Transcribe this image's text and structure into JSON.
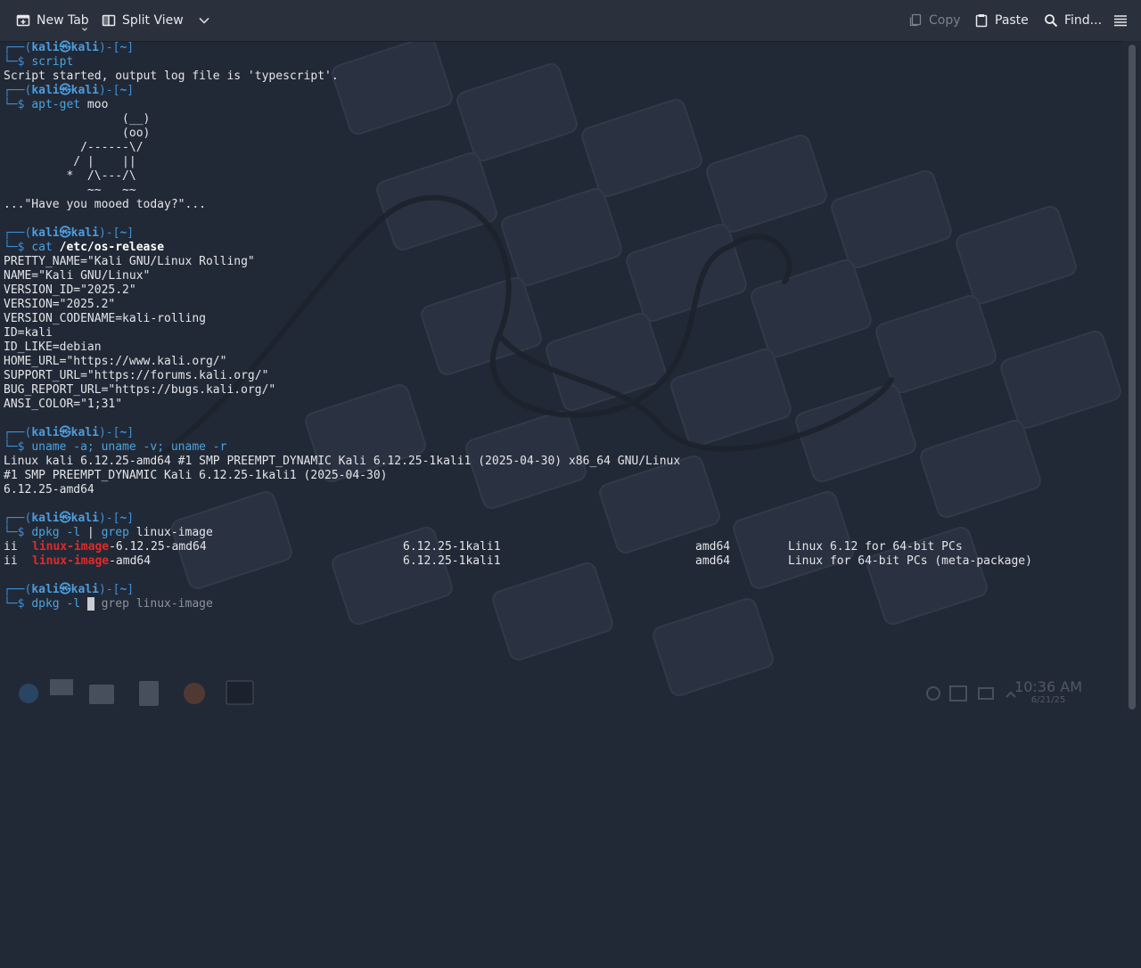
{
  "toolbar": {
    "new_tab": "New Tab",
    "split_view": "Split View",
    "copy": "Copy",
    "paste": "Paste",
    "find": "Find..."
  },
  "prompt": {
    "user": "kali",
    "host": "kali",
    "dir": "~"
  },
  "terminal": {
    "l1_cmd": "script",
    "l2": "Script started, output log file is 'typescript'.",
    "l4_cmd": "apt-get",
    "l4_arg": " moo",
    "cow1": "                 (__)",
    "cow2": "                 (oo)",
    "cow3": "           /------\\/",
    "cow4": "          / |    ||",
    "cow5": "         *  /\\---/\\",
    "cow6": "            ~~   ~~",
    "moo": "...\"Have you mooed today?\"...",
    "cat_cmd": "cat",
    "cat_arg": "/etc/os-release",
    "os": [
      "PRETTY_NAME=\"Kali GNU/Linux Rolling\"",
      "NAME=\"Kali GNU/Linux\"",
      "VERSION_ID=\"2025.2\"",
      "VERSION=\"2025.2\"",
      "VERSION_CODENAME=kali-rolling",
      "ID=kali",
      "ID_LIKE=debian",
      "HOME_URL=\"https://www.kali.org/\"",
      "SUPPORT_URL=\"https://forums.kali.org/\"",
      "BUG_REPORT_URL=\"https://bugs.kali.org/\"",
      "ANSI_COLOR=\"1;31\""
    ],
    "uname_cmd": "uname -a; uname -v; uname -r",
    "uname_out": [
      "Linux kali 6.12.25-amd64 #1 SMP PREEMPT_DYNAMIC Kali 6.12.25-1kali1 (2025-04-30) x86_64 GNU/Linux",
      "#1 SMP PREEMPT_DYNAMIC Kali 6.12.25-1kali1 (2025-04-30)",
      "6.12.25-amd64"
    ],
    "dpkg_cmd": "dpkg -l",
    "pipe": " | ",
    "grep_cmd": "grep",
    "grep_arg": " linux-image",
    "rows": [
      {
        "status": "ii",
        "match": "linux-image",
        "rest": "-6.12.25-amd64",
        "version": "6.12.25-1kali1",
        "arch": "amd64",
        "desc": "Linux 6.12 for 64-bit PCs"
      },
      {
        "status": "ii",
        "match": "linux-image",
        "rest": "-amd64",
        "version": "6.12.25-1kali1",
        "arch": "amd64",
        "desc": "Linux for 64-bit PCs (meta-package)"
      }
    ],
    "current_cmd": "dpkg -l ",
    "current_cursor": "|",
    "current_sugg": " grep linux-image"
  },
  "taskbar": {
    "time": "10:36 AM",
    "date": "6/21/25"
  },
  "colors": {
    "background": "#222936",
    "prompt": "#3d8fd6",
    "command": "#4aa3df",
    "highlight": "#e02a2a"
  }
}
